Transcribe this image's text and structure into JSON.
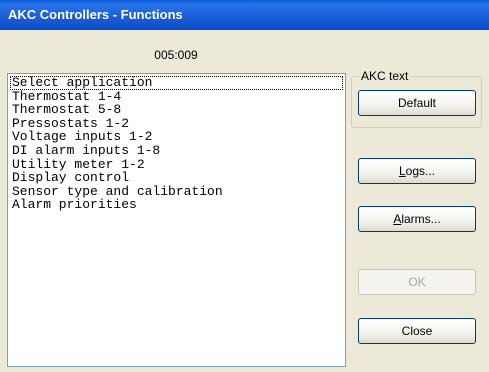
{
  "window": {
    "title": "AKC Controllers - Functions"
  },
  "header": {
    "code": "005:009"
  },
  "list": {
    "items": [
      "Select application",
      "Thermostat 1-4",
      "Thermostat 5-8",
      "Pressostats 1-2",
      "Voltage inputs 1-2",
      "DI alarm inputs 1-8",
      "Utility meter 1-2",
      "Display control",
      "Sensor type and calibration",
      "Alarm priorities"
    ],
    "focused_index": 0
  },
  "akc_text": {
    "legend": "AKC text",
    "default_label": "Default"
  },
  "buttons": {
    "logs": {
      "mnemonic": "L",
      "rest": "ogs..."
    },
    "alarms": {
      "mnemonic": "A",
      "rest": "larms..."
    },
    "ok": "OK",
    "close": "Close"
  },
  "colors": {
    "titlebar": "#0a5bdb",
    "dialog_bg": "#ece9d8",
    "disabled_text": "#a7a69b"
  }
}
